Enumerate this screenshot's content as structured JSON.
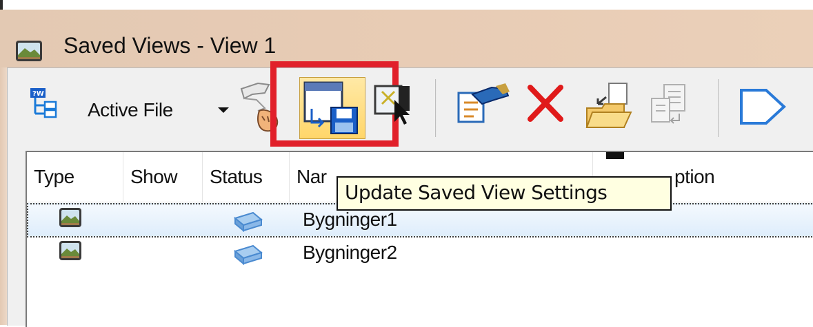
{
  "window": {
    "title": "Saved Views - View 1"
  },
  "toolbar": {
    "source_label": "Active File",
    "buttons": [
      {
        "icon": "view-hierarchy-icon"
      },
      {
        "icon": "source-dropdown-icon"
      },
      {
        "icon": "apply-view-icon"
      },
      {
        "icon": "update-saved-view-icon"
      },
      {
        "icon": "capture-view-icon"
      },
      {
        "icon": "properties-icon"
      },
      {
        "icon": "delete-icon"
      },
      {
        "icon": "import-icon"
      },
      {
        "icon": "export-icon"
      },
      {
        "icon": "filter-icon"
      }
    ]
  },
  "tooltip": {
    "text": "Update Saved View Settings"
  },
  "list": {
    "columns": [
      "Type",
      "Show",
      "Status",
      "Nar",
      "ption"
    ],
    "rows": [
      {
        "name": "Bygninger1",
        "selected": true
      },
      {
        "name": "Bygninger2",
        "selected": false
      }
    ]
  },
  "colors": {
    "highlight": "#e1202a",
    "selected_button": "#ffd66a",
    "tooltip_bg": "#ffffe1",
    "title_bar": "#e7cbb4"
  }
}
